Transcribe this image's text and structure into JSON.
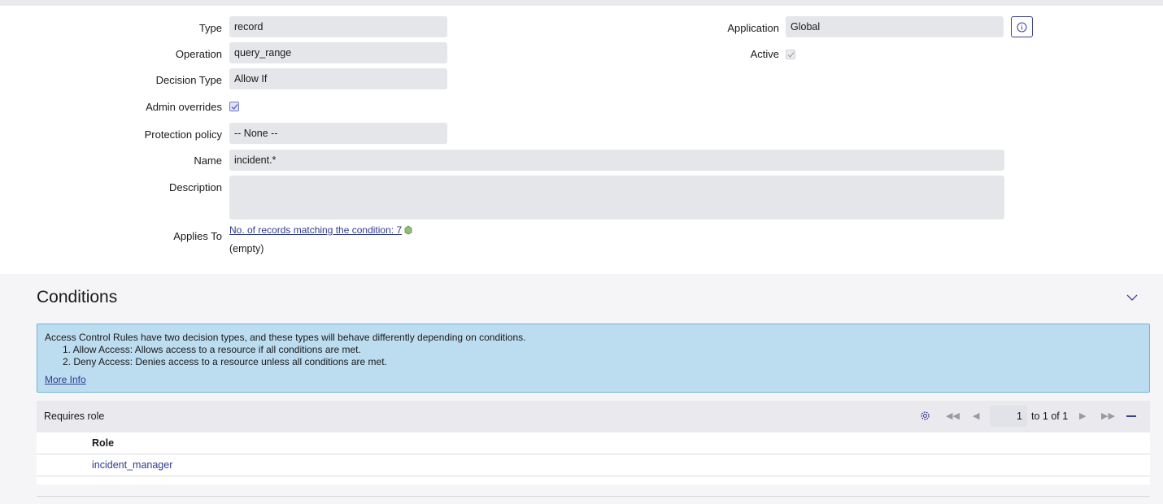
{
  "form": {
    "type": {
      "label": "Type",
      "value": "record"
    },
    "operation": {
      "label": "Operation",
      "value": "query_range"
    },
    "decision_type": {
      "label": "Decision Type",
      "value": "Allow If"
    },
    "admin_overrides": {
      "label": "Admin overrides",
      "checked": true
    },
    "protection_policy": {
      "label": "Protection policy",
      "value": "-- None --"
    },
    "name": {
      "label": "Name",
      "value": "incident.*"
    },
    "description": {
      "label": "Description",
      "value": ""
    },
    "applies_to": {
      "label": "Applies To",
      "link": "No. of records matching the condition: 7",
      "value": "(empty)"
    },
    "application": {
      "label": "Application",
      "value": "Global"
    },
    "active": {
      "label": "Active",
      "checked": true
    }
  },
  "conditions": {
    "title": "Conditions",
    "alert": {
      "intro": "Access Control Rules have two decision types, and these types will behave differently depending on conditions.",
      "item1": "1. Allow Access: Allows access to a resource if all conditions are met.",
      "item2": "2. Deny Access: Denies access to a resource unless all conditions are met.",
      "more": "More Info"
    }
  },
  "related_list": {
    "title": "Requires role",
    "page_input": "1",
    "page_info": "to 1 of 1",
    "column": "Role",
    "rows": [
      "incident_manager"
    ]
  },
  "colors": {
    "accent": "#2f3a8f",
    "field_bg": "#e5e6ea",
    "alert_bg": "#bcdcef",
    "alert_border": "#6fb4d9"
  }
}
